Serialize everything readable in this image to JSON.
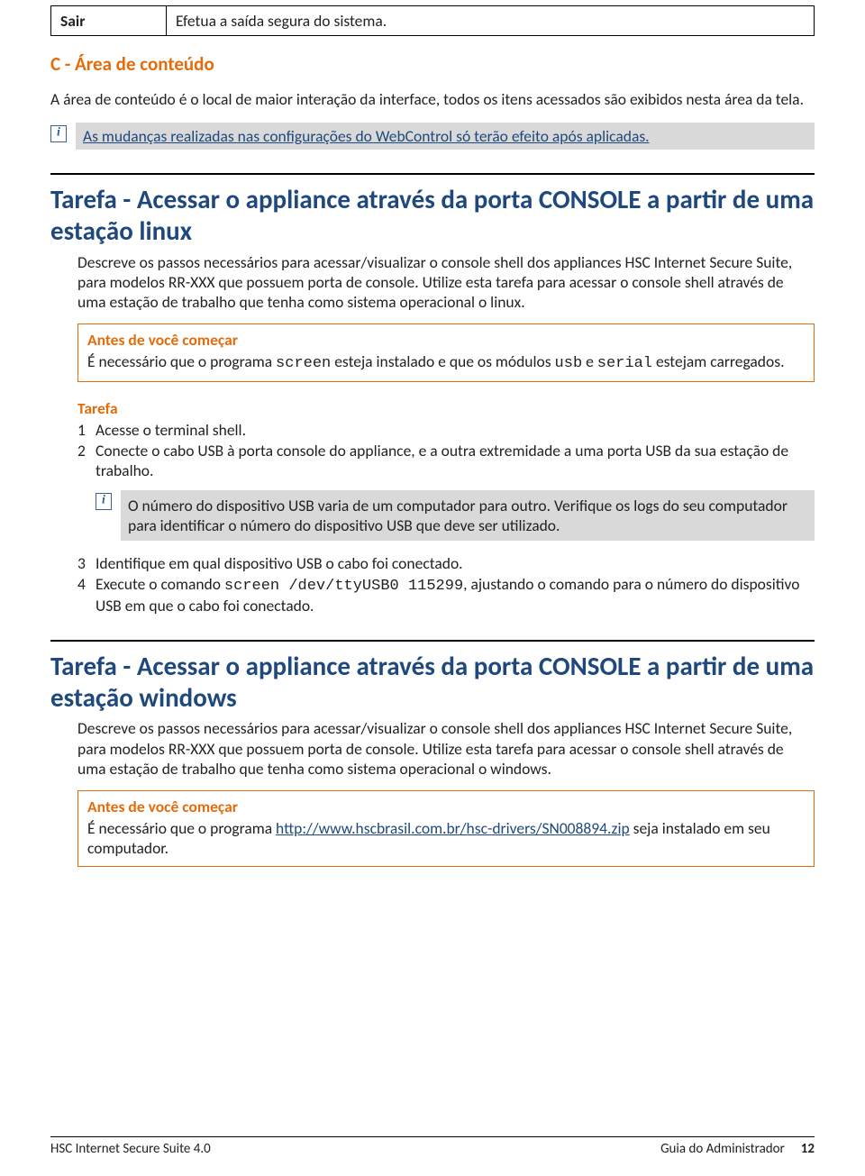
{
  "table_sair": {
    "key": "Sair",
    "desc": "Efetua a saída segura do sistema."
  },
  "section_c": {
    "title": "C - Área de conteúdo",
    "paragraph": "A área de conteúdo é o local de maior interação da interface, todos os itens acessados são exibidos nesta área da tela.",
    "info": "As mudanças realizadas nas configurações do WebControl só terão efeito após aplicadas."
  },
  "task_linux": {
    "title": "Tarefa - Acessar o appliance através da porta CONSOLE a partir de uma estação linux",
    "desc": "Descreve os passos necessários para acessar/visualizar o console shell dos appliances HSC Internet Secure Suite, para modelos RR-XXX que possuem porta de console. Utilize esta tarefa para acessar o console shell através de uma estação de trabalho que tenha como sistema operacional o linux.",
    "before_title": "Antes de você começar",
    "before_pre": "É necessário que o programa ",
    "before_screen": "screen",
    "before_mid": " esteja instalado e que os módulos ",
    "before_usb": "usb",
    "before_and": " e ",
    "before_serial": "serial",
    "before_post": " estejam carregados.",
    "tarefa_label": "Tarefa",
    "step1": "Acesse o terminal shell.",
    "step2": "Conecte o cabo USB à porta console do appliance, e a outra extremidade a uma porta USB da sua estação de trabalho.",
    "info2": "O número do dispositivo USB varia de um computador para outro. Verifique  os logs do seu computador para identificar o  número do  dispositivo USB que deve ser utilizado.",
    "step3": "Identifique em  qual dispositivo USB o cabo foi conectado.",
    "step4_pre": "Execute o comando ",
    "step4_cmd": "screen /dev/ttyUSB0 115299",
    "step4_post": ", ajustando o comando para o número do dispositivo USB em que o cabo foi conectado."
  },
  "task_win": {
    "title": "Tarefa - Acessar o appliance através da porta CONSOLE a partir de uma estação windows",
    "desc": "Descreve os passos necessários para acessar/visualizar o console shell dos appliances HSC Internet Secure Suite, para modelos RR-XXX que possuem porta de console. Utilize esta tarefa para acessar o console shell através de uma estação de trabalho que tenha como sistema operacional o windows.",
    "before_title": "Antes de você começar",
    "before_pre": "É necessário que o programa ",
    "before_link": "http://www.hscbrasil.com.br/hsc-drivers/SN008894.zip",
    "before_post": " seja instalado em seu computador."
  },
  "footer": {
    "left": "HSC Internet Secure Suite 4.0",
    "right": "Guia do Administrador",
    "page": "12"
  }
}
